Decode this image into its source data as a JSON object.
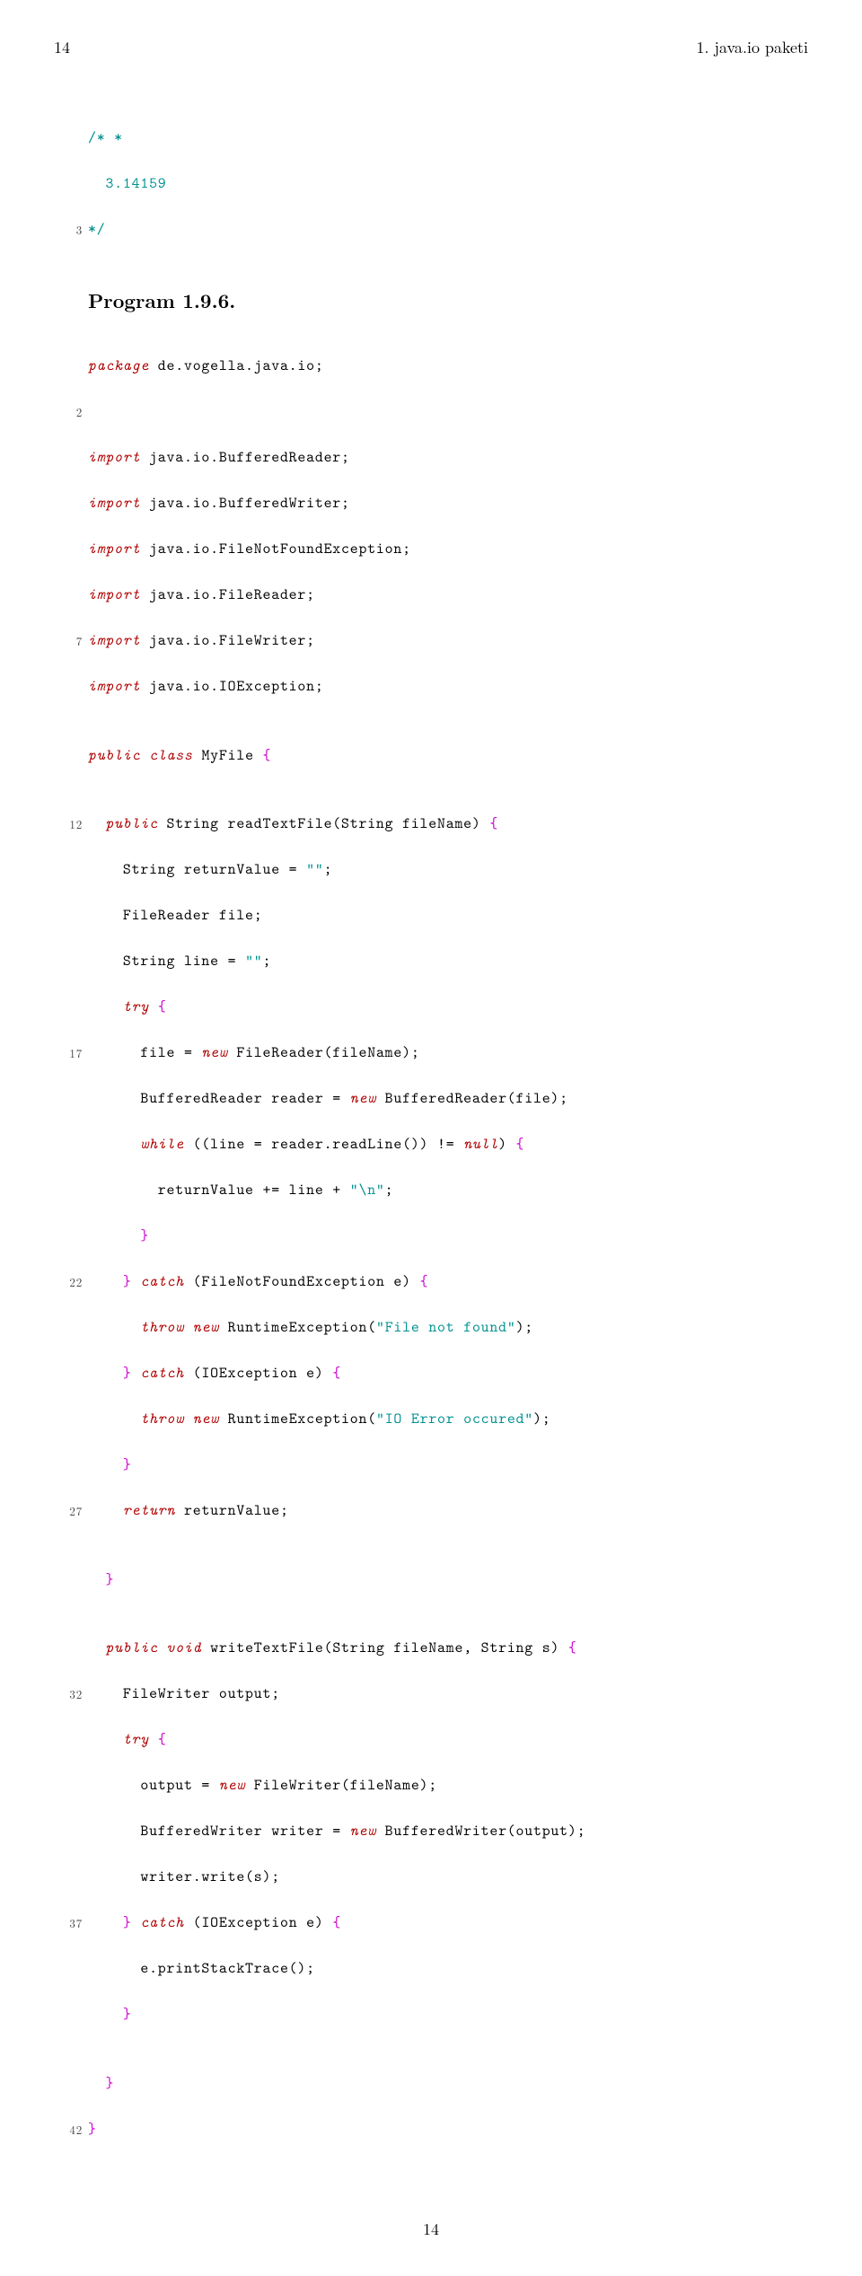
{
  "header": {
    "page_num_top": "14",
    "section": "1. java.io paketi"
  },
  "snippet1": {
    "l1": "/∗ ∗",
    "l2": "  3.14159",
    "l3": "∗/",
    "gutter3": "3"
  },
  "program_heading": "Program 1.9.6.",
  "kw": {
    "package": "package",
    "import": "import",
    "public": "public",
    "class": "class",
    "try": "try",
    "while": "while",
    "return": "return",
    "void": "void",
    "throw": "throw",
    "catch": "catch",
    "new": "new",
    "null": "null"
  },
  "code": {
    "l1_a": " de.vogella.java.io;",
    "l3_a": " java.io.BufferedReader;",
    "l4_a": " java.io.BufferedWriter;",
    "l5_a": " java.io.FileNotFoundException;",
    "l6_a": " java.io.FileReader;",
    "l7_a": " java.io.FileWriter;",
    "l8_a": " java.io.IOException;",
    "l10_a": " MyFile ",
    "l12_a": " String readTextFile(String fileName) ",
    "l13_a": "    String returnValue = ",
    "l13_b": ";",
    "l14_a": "    FileReader file;",
    "l15_a": "    String line = ",
    "l15_b": ";",
    "l17_a": "      file = ",
    "l17_b": " FileReader(fileName);",
    "l18_a": "      BufferedReader reader = ",
    "l18_b": " BufferedReader(file);",
    "l19_a": " ((line = reader.readLine()) != ",
    "l19_b": ") ",
    "l20_a": "        returnValue += line + ",
    "l20_b": ";",
    "l22_a": " (FileNotFoundException e) ",
    "l23_a": " RuntimeException(",
    "l23_b": ");",
    "l24_a": " (IOException e) ",
    "l25_a": " RuntimeException(",
    "l25_b": ");",
    "l27_a": " returnValue;",
    "l31_a": " writeTextFile(String fileName, String s) ",
    "l32_a": "    FileWriter output;",
    "l34_a": "      output = ",
    "l34_b": " FileWriter(fileName);",
    "l35_a": "      BufferedWriter writer = ",
    "l35_b": " BufferedWriter(output);",
    "l36_a": "      writer.write(s);",
    "l37_a": " (IOException e) ",
    "l38_a": "      e.printStackTrace();"
  },
  "str": {
    "empty": "\"\"",
    "nl": "\"\\n\"",
    "fnf": "\"File not found\"",
    "ioerr": "\"IO Error occured\""
  },
  "gut": {
    "g2": "2",
    "g7": "7",
    "g12": "12",
    "g17": "17",
    "g22": "22",
    "g27": "27",
    "g32": "32",
    "g37": "37",
    "g42": "42"
  },
  "footer_num": "14"
}
